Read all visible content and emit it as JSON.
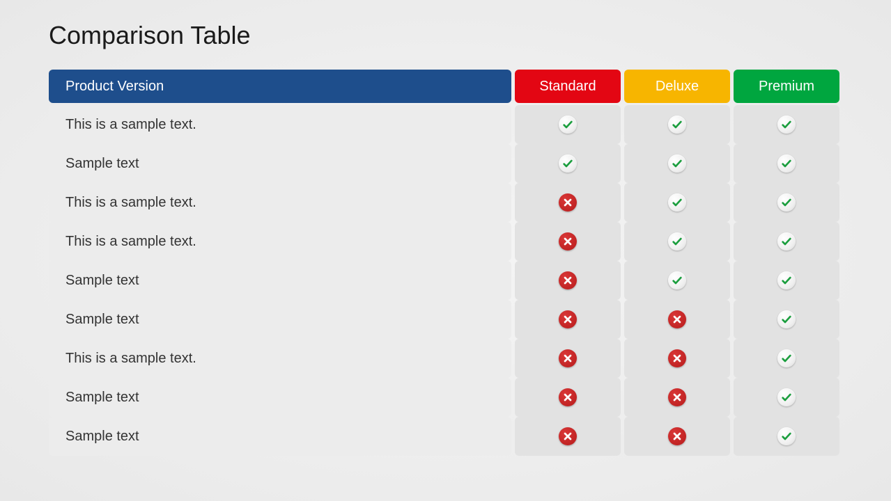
{
  "title": "Comparison Table",
  "header": {
    "feature": "Product Version",
    "columns": [
      "Standard",
      "Deluxe",
      "Premium"
    ],
    "column_colors": [
      "#e30613",
      "#f7b500",
      "#00a63f"
    ]
  },
  "rows": [
    {
      "label": "This is a sample text.",
      "values": [
        true,
        true,
        true
      ]
    },
    {
      "label": "Sample text",
      "values": [
        true,
        true,
        true
      ]
    },
    {
      "label": "This is a sample text.",
      "values": [
        false,
        true,
        true
      ]
    },
    {
      "label": "This is a sample text.",
      "values": [
        false,
        true,
        true
      ]
    },
    {
      "label": "Sample text",
      "values": [
        false,
        true,
        true
      ]
    },
    {
      "label": "Sample text",
      "values": [
        false,
        false,
        true
      ]
    },
    {
      "label": "This is a sample text.",
      "values": [
        false,
        false,
        true
      ]
    },
    {
      "label": "Sample text",
      "values": [
        false,
        false,
        true
      ]
    },
    {
      "label": "Sample text",
      "values": [
        false,
        false,
        true
      ]
    }
  ]
}
